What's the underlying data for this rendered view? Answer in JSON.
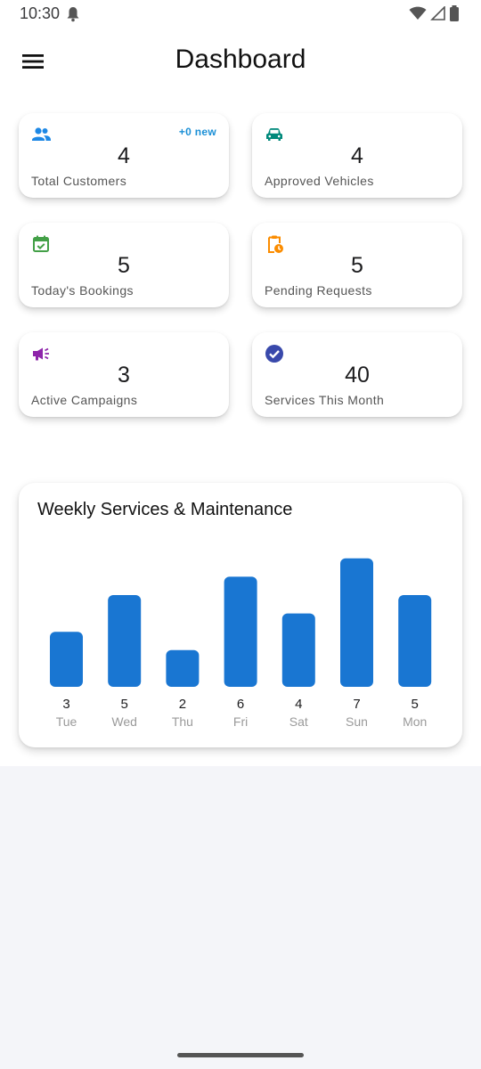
{
  "status_bar": {
    "time": "10:30"
  },
  "header": {
    "title": "Dashboard"
  },
  "stats": [
    {
      "label": "Total Customers",
      "value": "4",
      "badge": "+0 new",
      "icon": "people-icon",
      "color": "#1e88e5"
    },
    {
      "label": "Approved Vehicles",
      "value": "4",
      "icon": "car-icon",
      "color": "#00897b"
    },
    {
      "label": "Today's Bookings",
      "value": "5",
      "icon": "calendar-check-icon",
      "color": "#43a047"
    },
    {
      "label": "Pending Requests",
      "value": "5",
      "icon": "clipboard-clock-icon",
      "color": "#fb8c00"
    },
    {
      "label": "Active Campaigns",
      "value": "3",
      "icon": "megaphone-icon",
      "color": "#8e24aa"
    },
    {
      "label": "Services This Month",
      "value": "40",
      "icon": "check-circle-icon",
      "color": "#3949ab"
    }
  ],
  "chart_data": {
    "type": "bar",
    "title": "Weekly Services & Maintenance",
    "categories": [
      "Tue",
      "Wed",
      "Thu",
      "Fri",
      "Sat",
      "Sun",
      "Mon"
    ],
    "values": [
      3,
      5,
      2,
      6,
      4,
      7,
      5
    ],
    "bar_color": "#1976d2",
    "grid": false,
    "legend": "none"
  }
}
